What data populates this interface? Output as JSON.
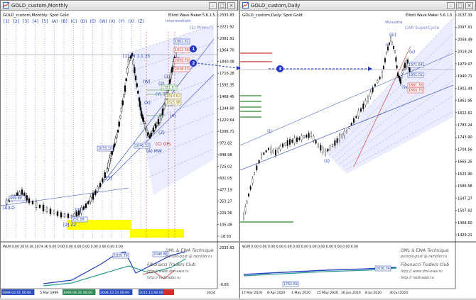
{
  "left": {
    "title": "GOLD_custom,Monthly",
    "symbol_line": "GOLD_custom,Monthly:  Spot Gold",
    "plugin_label": "Elliott Wave Maker 5.6.1.5",
    "top_waves": [
      "[1]",
      "[2]",
      "[3]",
      "[4]",
      "[5]",
      "(A)",
      "(B)",
      "(C)",
      "(D)",
      "(E)",
      "(W)",
      "(X)",
      "(Y)",
      "(X)",
      "(Z)"
    ],
    "right_top_labels": [
      "Primary",
      "Intermediate"
    ],
    "price_axis": [
      "2335.83",
      "2221.92",
      "2081.91",
      "1964.70",
      "1840.08",
      "1716.28",
      "1592.35",
      "1468.45",
      "1344.60",
      "1220.64",
      "1096.71",
      "972.82",
      "848.98",
      "725.02",
      "601.05",
      "477.19",
      "353.27",
      "229.36",
      "105.48",
      "-18.50"
    ],
    "wave_labels": [
      {
        "t": "(A)LD"
      },
      {
        "t": "[2] ZZ"
      },
      {
        "t": "[3]"
      },
      {
        "t": "[3]"
      },
      {
        "t": "[1] IM 1.1.3S"
      },
      {
        "t": "(W)"
      },
      {
        "t": "(X)"
      },
      {
        "t": "(Y) TL"
      },
      {
        "t": "(Z)"
      },
      {
        "t": "(A) MW"
      },
      {
        "t": "(C) GPL"
      },
      {
        "t": "[B]"
      },
      {
        "t": "(3)"
      },
      {
        "t": "(4)"
      },
      {
        "t": "(1)"
      },
      {
        "t": "(2)"
      }
    ],
    "price_boxes": [
      "1922.56",
      "1902.62",
      "1033.10",
      "1046.32",
      "2056.79",
      "2038.53",
      "1814.62",
      "1823.98",
      "1781.67",
      "499.88",
      "251.08"
    ],
    "indicator_label": "WLM 0.00 2074.36 2074.36 0.00 0.00 0.00 0.00 0.00 0.00 0.00 0.00 0.00",
    "indicator_axis": [
      "2335.83",
      "-0.83"
    ],
    "indicator_boxes": [
      "1920.79",
      "2046.88"
    ],
    "watermark": [
      "DML & EWA Technique",
      "putsolo-post @ rambler.ru",
      "Fibonacci Traders Club",
      "http:// www.dml-ewa.ru",
      "http:// redtrader.ru"
    ],
    "time_axis": [
      "1999.02.01 00:00",
      "5 Mar 1999",
      "1999.06.25 00:00",
      "2008.10.24 00:00",
      "2015.12.00 00:00",
      "2024"
    ],
    "colors": {
      "bg": "#ffffff",
      "wave": "#1f3fbf",
      "band": "#dfe3ff",
      "red": "#d0302a",
      "yellow": "#ffff00",
      "green": "#2e8b2e",
      "teal": "#2a9d8f",
      "candle": "#000000"
    }
  },
  "right": {
    "title": "GOLD_custom,Daily",
    "symbol_line": "GOLD_custom,Daily:  Spot Gold",
    "plugin_label": "Elliott Wave Maker 5.6.1.5",
    "top_labels": [
      "Minuette",
      "CAR  SuperCycle"
    ],
    "price_axis": [
      "2137.33",
      "2097.91",
      "2058.49",
      "2019.24",
      "1979.97",
      "1940.71",
      "1901.44",
      "1861.95",
      "1822.61",
      "1783.24",
      "1743.90",
      "1704.56",
      "1665.25",
      "1625.90",
      "1586.58",
      "1547.27",
      "1507.92",
      "1468.60",
      "1429.21"
    ],
    "price_boxes": [
      "1971.64",
      "1881.38",
      "1869.70",
      "1931.01"
    ],
    "wave_labels": [
      "(i)",
      "(ii)",
      "(iii)",
      "(iv)",
      "(v)",
      "i",
      "iv"
    ],
    "indicator_label": "WLM 0.00 0.00 0.00 0.00 0.00 0.00 0.00 0.00 0.00 0.00 0.00 0.00 0.00",
    "indicator_boxes": [
      "1762.69",
      "2016.34"
    ],
    "watermark": [
      "DML & EWA Technique",
      "putsolo-post @ rambler.ru",
      "Fibonacci Traders Club",
      "http:// www.dml-ewa.ru",
      "http:// redtrader.ru"
    ],
    "time_axis": [
      "17 Mar 2020",
      "8 Apr 2020",
      "1 May 2020",
      "25 May 2020",
      "16 Jun 2020",
      "8 Jul 2020",
      "30 Jul 2020"
    ]
  },
  "markers": [
    "1",
    "2",
    "3"
  ]
}
